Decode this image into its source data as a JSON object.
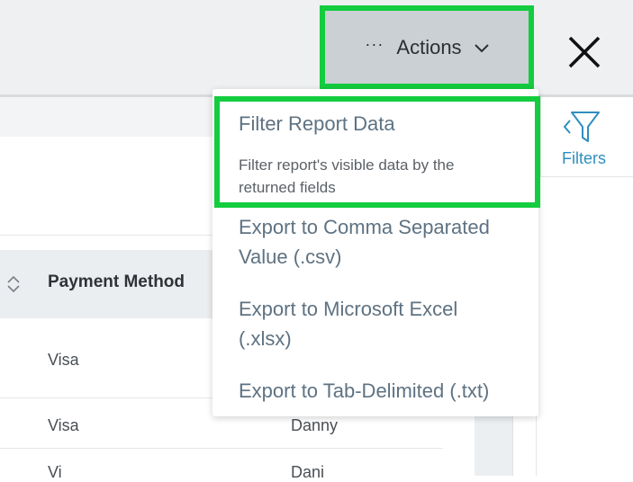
{
  "header": {
    "actions_label": "Actions",
    "actions_dots": "···"
  },
  "filters": {
    "label": "Filters"
  },
  "table": {
    "column_header": "Payment Method",
    "rows": [
      {
        "payment": "Visa",
        "name": ""
      },
      {
        "payment": "Visa",
        "name": "Danny"
      },
      {
        "payment": "Vi",
        "name": "Dani"
      }
    ]
  },
  "menu": {
    "items": [
      {
        "label": "Filter Report Data",
        "description": "Filter report's visible data by the returned fields"
      },
      {
        "label_line1": "Export to Comma Separated",
        "label_line2": "Value (.csv)"
      },
      {
        "label_line1": "Export to Microsoft Excel",
        "label_line2": "(.xlsx)"
      },
      {
        "label": "Export to Tab-Delimited (.txt)"
      }
    ]
  },
  "colors": {
    "highlight": "#13cc3f",
    "menu_text": "#5e7282",
    "filters_accent": "#2f8fbf"
  }
}
